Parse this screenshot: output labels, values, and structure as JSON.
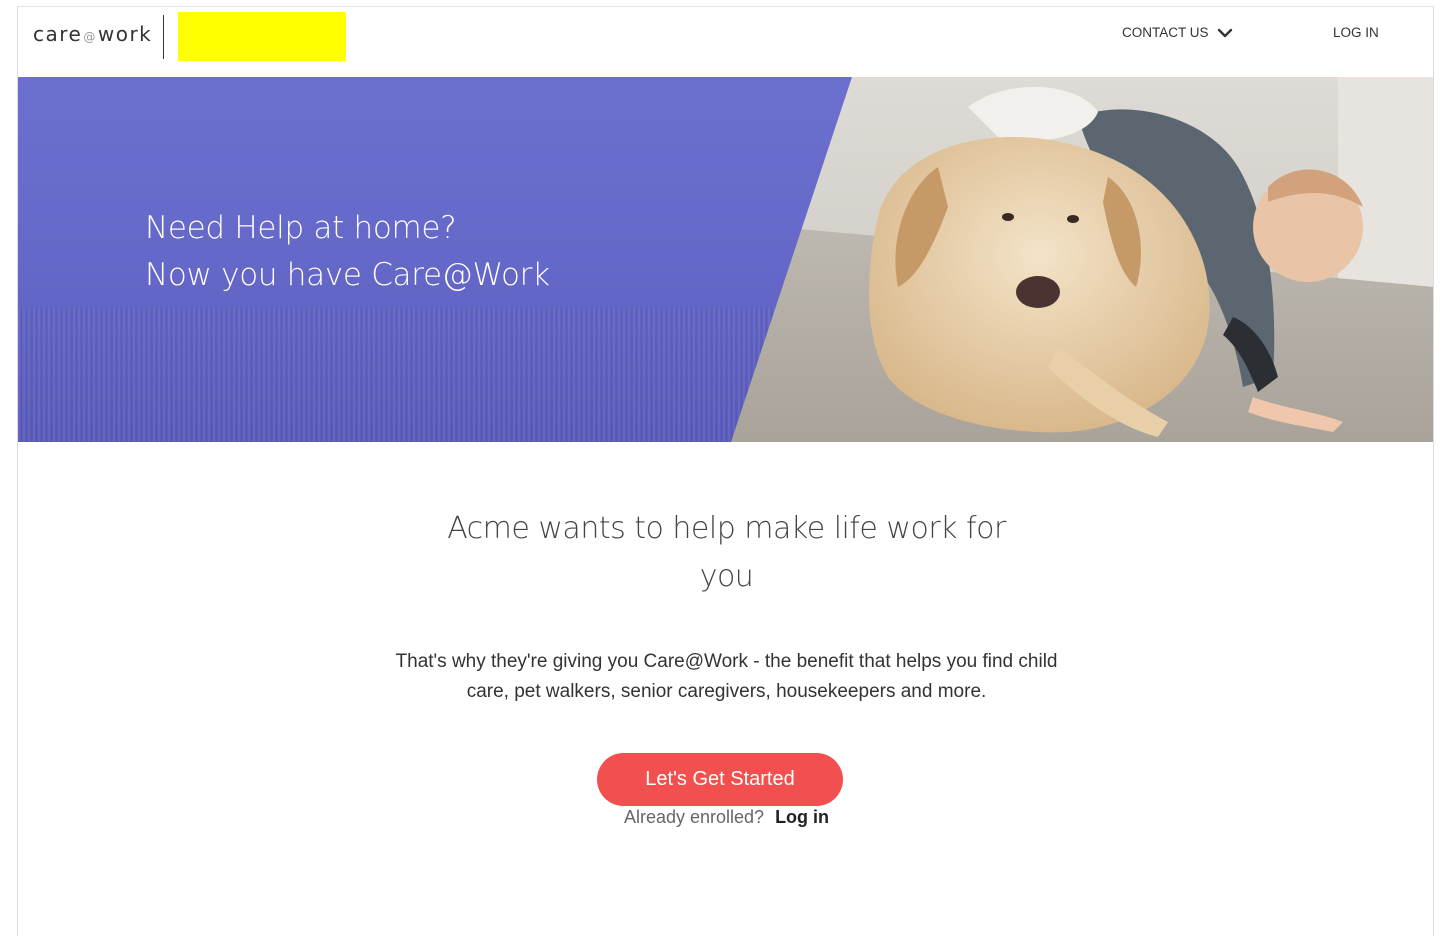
{
  "header": {
    "logo_text_1": "care",
    "logo_at": "@",
    "logo_text_2": "work",
    "contact_label": "CONTACT US",
    "login_label": "LOG IN"
  },
  "hero": {
    "line1": "Need Help at home?",
    "line2": "Now you have Care@Work"
  },
  "main": {
    "headline": "Acme wants to help make life work for you",
    "description": "That's why they're giving you Care@Work - the benefit that helps you find child care, pet walkers, senior caregivers, housekeepers and more.",
    "cta_label": "Let's Get Started",
    "enrolled_text": "Already enrolled?",
    "enrolled_link": "Log in"
  },
  "colors": {
    "hero_purple": "#6467c7",
    "cta_red": "#f2504f",
    "partner_logo_placeholder": "#ffff00"
  },
  "icons": {
    "contact_dropdown": "chevron-down-icon"
  }
}
